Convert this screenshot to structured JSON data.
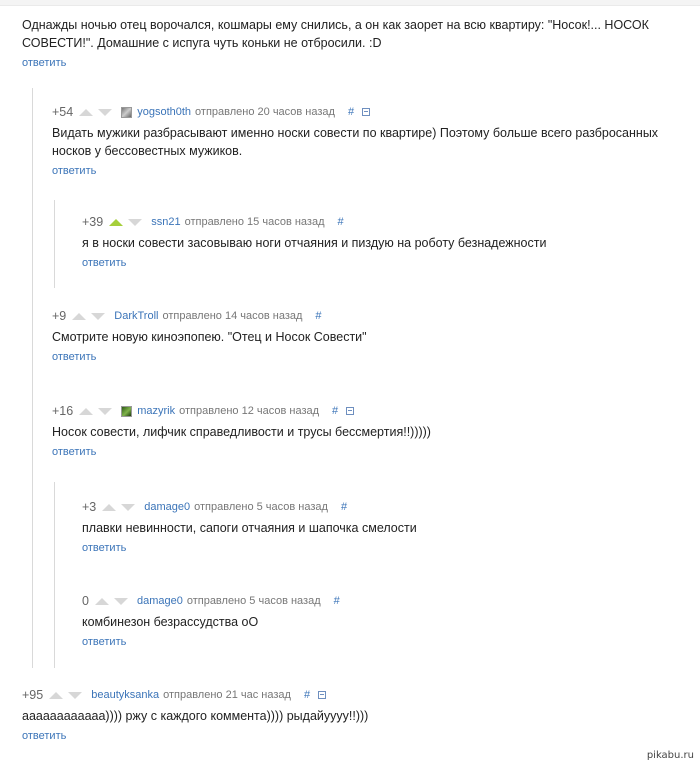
{
  "top_comment": {
    "text": "Однажды ночью отец ворочался, кошмары ему снились, а он как заорет на всю квартиру: \"Носок!... НОСОК СОВЕСТИ!\". Домашние с испуга чуть коньки не отбросили. :D",
    "reply_label": "ответить"
  },
  "comments": [
    {
      "rating": "+54",
      "user": "yogsoth0th",
      "meta": "отправлено 20 часов назад",
      "hash": "#",
      "avatar": "gray-photo",
      "text": "Видать мужики разбрасывают именно носки совести по квартире) Поэтому больше всего разбросанных носков у бессовестных мужиков.",
      "reply_label": "ответить"
    },
    {
      "rating": "+39",
      "user": "ssn21",
      "meta": "отправлено 15 часов назад",
      "hash": "#",
      "upvoted": true,
      "text": "я в носки совести засовываю ноги отчаяния и пиздую на роботу безнадежности",
      "reply_label": "ответить"
    },
    {
      "rating": "+9",
      "user": "DarkTroll",
      "meta": "отправлено 14 часов назад",
      "hash": "#",
      "text": "Смотрите новую киноэпопею. \"Отец и Носок Совести\"",
      "reply_label": "ответить"
    },
    {
      "rating": "+16",
      "user": "mazyrik",
      "meta": "отправлено 12 часов назад",
      "hash": "#",
      "avatar": "green-photo",
      "text": "Носок совести, лифчик справедливости и трусы бессмертия!!)))))",
      "reply_label": "ответить"
    },
    {
      "rating": "+3",
      "user": "damage0",
      "meta": "отправлено 5 часов назад",
      "hash": "#",
      "text": "плавки невинности, сапоги отчаяния и шапочка смелости",
      "reply_label": "ответить"
    },
    {
      "rating": "0",
      "user": "damage0",
      "meta": "отправлено 5 часов назад",
      "hash": "#",
      "text": "комбинезон безрассудства оО",
      "reply_label": "ответить"
    },
    {
      "rating": "+95",
      "user": "beautyksanka",
      "meta": "отправлено 21 час назад",
      "hash": "#",
      "text": "аааааааааааа)))) ржу с каждого коммента)))) рыдайуууу!!)))",
      "reply_label": "ответить"
    }
  ],
  "watermark": "pikabu.ru"
}
